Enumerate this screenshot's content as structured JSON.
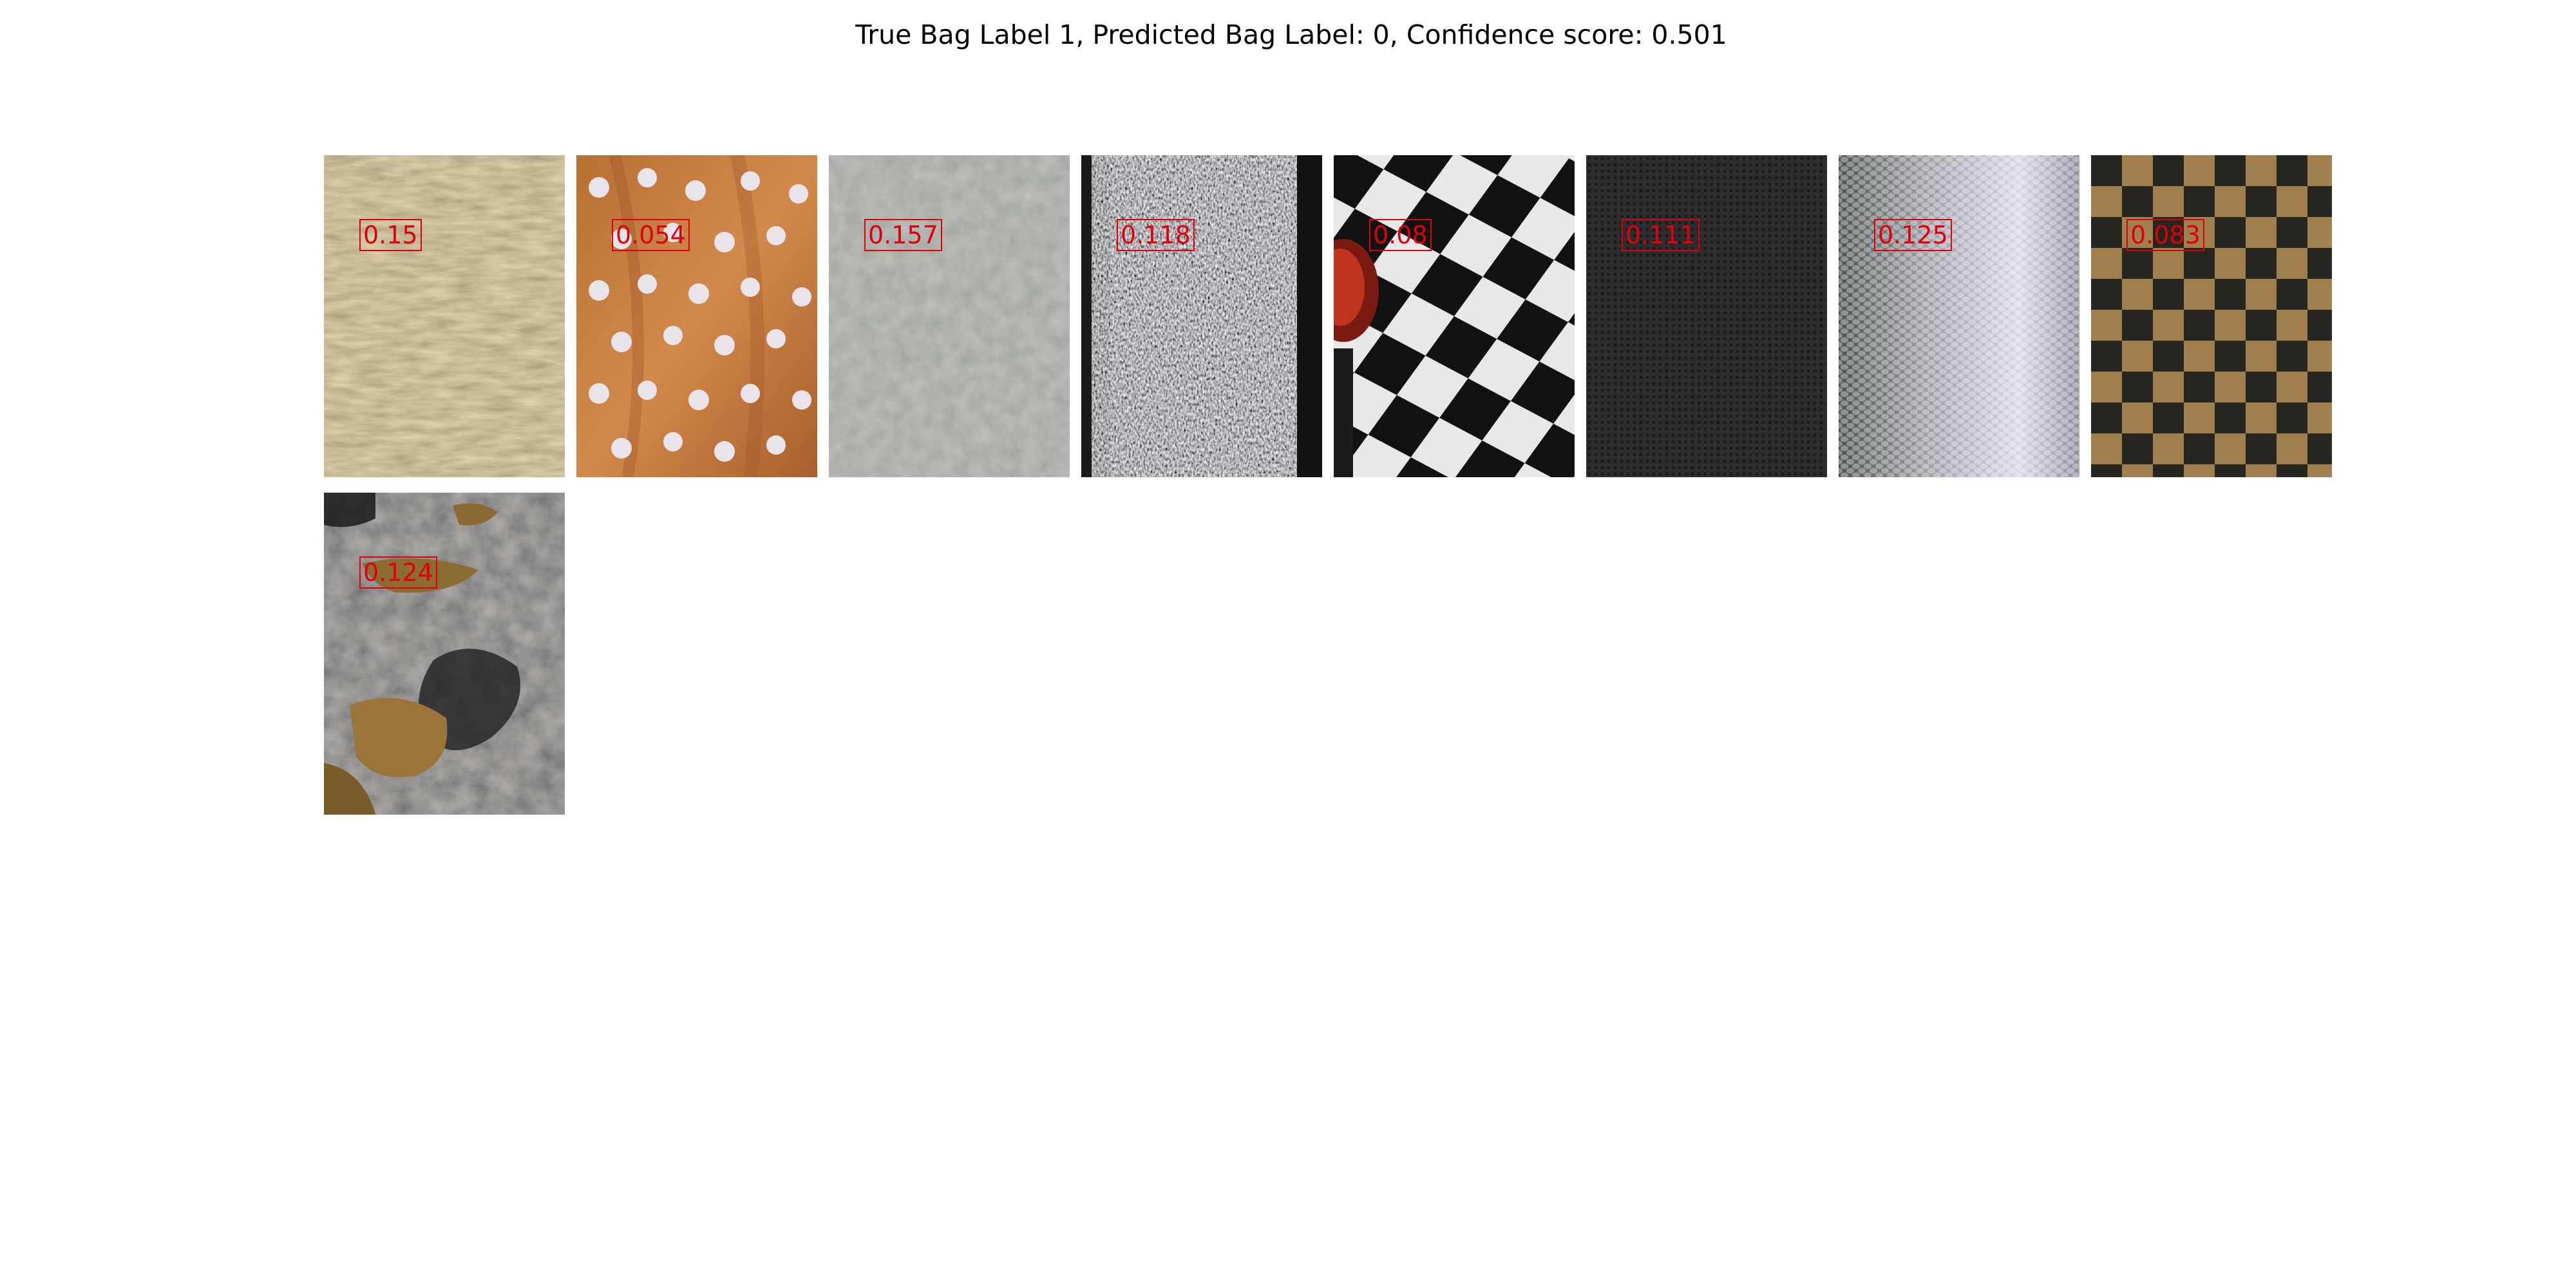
{
  "title": "True Bag Label 1, Predicted Bag Label: 0, Confidence score: 0.501",
  "score_color": "#e0000b",
  "instances": [
    {
      "score": "0.15",
      "texture": "dry-grass"
    },
    {
      "score": "0.054",
      "texture": "orange-polka-dot-fabric"
    },
    {
      "score": "0.157",
      "texture": "grey-concrete"
    },
    {
      "score": "0.118",
      "texture": "black-white-knit"
    },
    {
      "score": "0.08",
      "texture": "black-white-checkerboard"
    },
    {
      "score": "0.111",
      "texture": "dark-perforated-mesh"
    },
    {
      "score": "0.125",
      "texture": "metal-honeycomb-mesh"
    },
    {
      "score": "0.083",
      "texture": "wood-checkerboard"
    },
    {
      "score": "0.124",
      "texture": "muddy-asphalt"
    }
  ]
}
